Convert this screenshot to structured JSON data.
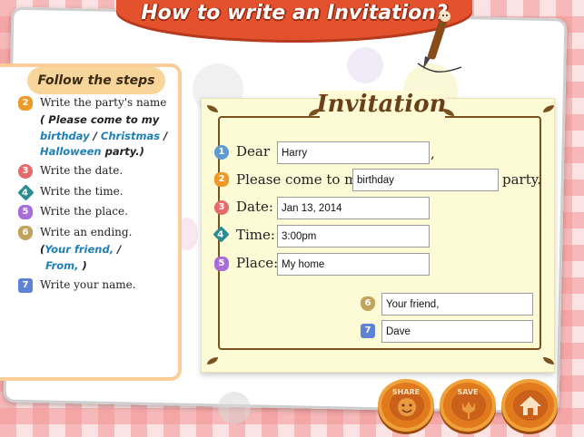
{
  "title": "How to write an Invitation?",
  "steps": {
    "header": "Follow the steps",
    "items": [
      {
        "num": "2",
        "text": "Write the party's name"
      },
      {
        "num": "3",
        "text": "Write the date."
      },
      {
        "num": "4",
        "text": "Write the time."
      },
      {
        "num": "5",
        "text": "Write the place."
      },
      {
        "num": "6",
        "text": "Write an ending."
      },
      {
        "num": "7",
        "text": "Write your name."
      }
    ],
    "hint_party": {
      "open": "( Please come to my",
      "birthday": "birthday",
      "sep1": " / ",
      "christmas": "Christmas",
      "sep2": " /",
      "halloween": "Halloween",
      "tail": " party.)"
    },
    "hint_ending": {
      "open": "(",
      "your_friend": "Your friend,",
      "sep": " /",
      "from": "From,",
      "close": " )"
    }
  },
  "card": {
    "title": "Invitation",
    "dear_label": "Dear",
    "dear_value": "Harry",
    "dear_comma": ",",
    "party_label": "Please come to my",
    "party_value": "birthday",
    "party_suffix": "party.",
    "date_label": "Date:",
    "date_value": "Jan 13, 2014",
    "time_label": "Time:",
    "time_value": "3:00pm",
    "place_label": "Place:",
    "place_value": "My home",
    "ending_value": "Your friend,",
    "name_value": "Dave",
    "badges": [
      "1",
      "2",
      "3",
      "4",
      "5",
      "6",
      "7"
    ]
  },
  "buttons": {
    "share": "SHARE",
    "save": "SAVE",
    "home_icon": "house-icon"
  },
  "colors": {
    "banner": "#e4512d",
    "card_bg": "#fdfbd6",
    "frame": "#7a5220",
    "hint_blue": "#1f7fb6",
    "button": "#e07a1c"
  }
}
